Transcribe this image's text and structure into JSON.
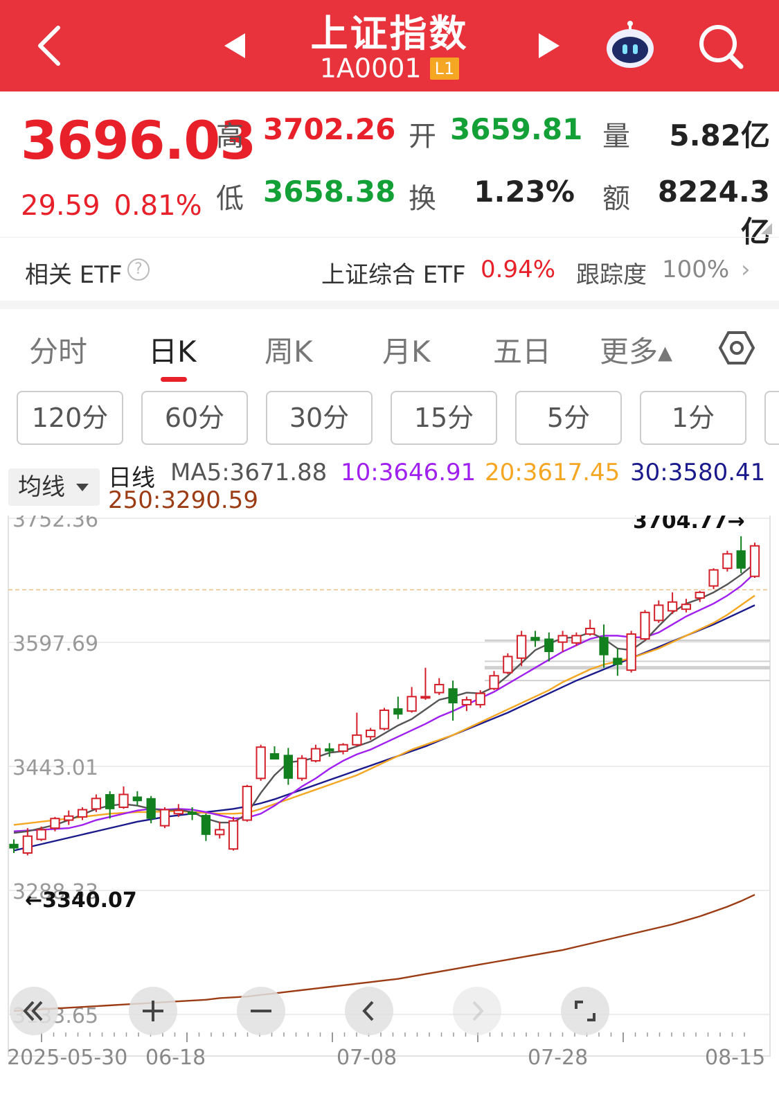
{
  "header": {
    "title": "上证指数",
    "code": "1A0001",
    "level_badge": "L1",
    "icons": [
      "back-chevron-icon",
      "prev-triangle-icon",
      "next-triangle-icon",
      "robot-assistant-icon",
      "search-icon"
    ]
  },
  "quote": {
    "price": "3696.03",
    "change": "29.59",
    "change_pct": "0.81%",
    "high_label": "高",
    "high": "3702.26",
    "low_label": "低",
    "low": "3658.38",
    "open_label": "开",
    "open": "3659.81",
    "turnover_label": "换",
    "turnover": "1.23%",
    "volume_label": "量",
    "volume": "5.82亿",
    "amount_label": "额",
    "amount": "8224.3亿"
  },
  "etf": {
    "label": "相关 ETF",
    "name": "上证综合 ETF",
    "pct": "0.94%",
    "tracking_label": "跟踪度",
    "tracking": "100%"
  },
  "tabs": [
    "分时",
    "日K",
    "周K",
    "月K",
    "五日",
    "更多▴"
  ],
  "active_tab": "日K",
  "periods": [
    "120分",
    "60分",
    "30分",
    "15分",
    "5分",
    "1分"
  ],
  "ma": {
    "selector": "均线",
    "prefix": "日线",
    "ma5": "MA5:3671.88",
    "ma10": "10:3646.91",
    "ma20": "20:3617.45",
    "ma30": "30:3580.41",
    "ma250": "250:3290.59",
    "colors": {
      "ma5": "#555555",
      "ma10": "#a020f0",
      "ma20": "#f5a623",
      "ma30": "#1a1a8c",
      "ma250": "#9c3c14"
    }
  },
  "chart_data": {
    "type": "candlestick",
    "y_ticks": [
      "3752.36",
      "3597.69",
      "3443.01",
      "3288.33",
      "3133.65"
    ],
    "ylim": [
      3133.65,
      3752.36
    ],
    "x_labels": [
      "2025-05-30",
      "06-18",
      "07-08",
      "07-28",
      "08-15"
    ],
    "high_marker": "3704.77→",
    "low_marker": "←3340.07",
    "up_color": "#d4202a",
    "down_color": "#12801e",
    "candles": [
      {
        "o": 3346,
        "h": 3352,
        "l": 3335,
        "c": 3341
      },
      {
        "o": 3335,
        "h": 3366,
        "l": 3332,
        "c": 3356
      },
      {
        "o": 3352,
        "h": 3368,
        "l": 3350,
        "c": 3364
      },
      {
        "o": 3366,
        "h": 3380,
        "l": 3362,
        "c": 3378
      },
      {
        "o": 3376,
        "h": 3388,
        "l": 3370,
        "c": 3381
      },
      {
        "o": 3380,
        "h": 3392,
        "l": 3376,
        "c": 3389
      },
      {
        "o": 3390,
        "h": 3408,
        "l": 3386,
        "c": 3403
      },
      {
        "o": 3408,
        "h": 3412,
        "l": 3378,
        "c": 3390
      },
      {
        "o": 3392,
        "h": 3418,
        "l": 3390,
        "c": 3408
      },
      {
        "o": 3405,
        "h": 3412,
        "l": 3394,
        "c": 3400
      },
      {
        "o": 3403,
        "h": 3406,
        "l": 3372,
        "c": 3378
      },
      {
        "o": 3369,
        "h": 3392,
        "l": 3366,
        "c": 3389
      },
      {
        "o": 3384,
        "h": 3396,
        "l": 3380,
        "c": 3388
      },
      {
        "o": 3386,
        "h": 3392,
        "l": 3376,
        "c": 3383
      },
      {
        "o": 3382,
        "h": 3384,
        "l": 3350,
        "c": 3358
      },
      {
        "o": 3358,
        "h": 3374,
        "l": 3353,
        "c": 3364
      },
      {
        "o": 3340,
        "h": 3380,
        "l": 3338,
        "c": 3375
      },
      {
        "o": 3376,
        "h": 3420,
        "l": 3374,
        "c": 3418
      },
      {
        "o": 3428,
        "h": 3470,
        "l": 3425,
        "c": 3467
      },
      {
        "o": 3459,
        "h": 3468,
        "l": 3452,
        "c": 3452
      },
      {
        "o": 3457,
        "h": 3466,
        "l": 3420,
        "c": 3428
      },
      {
        "o": 3428,
        "h": 3457,
        "l": 3425,
        "c": 3453
      },
      {
        "o": 3450,
        "h": 3470,
        "l": 3448,
        "c": 3465
      },
      {
        "o": 3465,
        "h": 3472,
        "l": 3455,
        "c": 3462
      },
      {
        "o": 3462,
        "h": 3472,
        "l": 3458,
        "c": 3470
      },
      {
        "o": 3470,
        "h": 3510,
        "l": 3468,
        "c": 3482
      },
      {
        "o": 3480,
        "h": 3491,
        "l": 3476,
        "c": 3488
      },
      {
        "o": 3490,
        "h": 3516,
        "l": 3488,
        "c": 3513
      },
      {
        "o": 3515,
        "h": 3530,
        "l": 3502,
        "c": 3508
      },
      {
        "o": 3512,
        "h": 3542,
        "l": 3510,
        "c": 3530
      },
      {
        "o": 3530,
        "h": 3566,
        "l": 3526,
        "c": 3530
      },
      {
        "o": 3535,
        "h": 3553,
        "l": 3532,
        "c": 3545
      },
      {
        "o": 3540,
        "h": 3550,
        "l": 3500,
        "c": 3522
      },
      {
        "o": 3520,
        "h": 3530,
        "l": 3512,
        "c": 3526
      },
      {
        "o": 3520,
        "h": 3538,
        "l": 3516,
        "c": 3534
      },
      {
        "o": 3540,
        "h": 3562,
        "l": 3538,
        "c": 3556
      },
      {
        "o": 3560,
        "h": 3584,
        "l": 3558,
        "c": 3580
      },
      {
        "o": 3578,
        "h": 3612,
        "l": 3568,
        "c": 3606
      },
      {
        "o": 3604,
        "h": 3612,
        "l": 3592,
        "c": 3600
      },
      {
        "o": 3602,
        "h": 3610,
        "l": 3574,
        "c": 3586
      },
      {
        "o": 3598,
        "h": 3612,
        "l": 3586,
        "c": 3606
      },
      {
        "o": 3597,
        "h": 3610,
        "l": 3593,
        "c": 3606
      },
      {
        "o": 3608,
        "h": 3626,
        "l": 3606,
        "c": 3615
      },
      {
        "o": 3604,
        "h": 3620,
        "l": 3566,
        "c": 3582
      },
      {
        "o": 3578,
        "h": 3590,
        "l": 3556,
        "c": 3570
      },
      {
        "o": 3563,
        "h": 3612,
        "l": 3560,
        "c": 3608
      },
      {
        "o": 3602,
        "h": 3638,
        "l": 3600,
        "c": 3635
      },
      {
        "o": 3625,
        "h": 3650,
        "l": 3622,
        "c": 3644
      },
      {
        "o": 3637,
        "h": 3660,
        "l": 3633,
        "c": 3648
      },
      {
        "o": 3639,
        "h": 3652,
        "l": 3635,
        "c": 3645
      },
      {
        "o": 3653,
        "h": 3662,
        "l": 3648,
        "c": 3660
      },
      {
        "o": 3668,
        "h": 3690,
        "l": 3664,
        "c": 3688
      },
      {
        "o": 3690,
        "h": 3712,
        "l": 3686,
        "c": 3708
      },
      {
        "o": 3712,
        "h": 3730,
        "l": 3684,
        "c": 3690
      },
      {
        "o": 3680,
        "h": 3722,
        "l": 3678,
        "c": 3718
      }
    ],
    "ma5": [
      3360,
      3362,
      3366,
      3370,
      3376,
      3383,
      3390,
      3394,
      3396,
      3394,
      3390,
      3388,
      3389,
      3386,
      3378,
      3373,
      3373,
      3384,
      3410,
      3432,
      3448,
      3450,
      3454,
      3460,
      3462,
      3468,
      3474,
      3484,
      3494,
      3502,
      3514,
      3526,
      3530,
      3535,
      3534,
      3542,
      3556,
      3572,
      3588,
      3596,
      3603,
      3604,
      3610,
      3602,
      3590,
      3588,
      3600,
      3618,
      3635,
      3646,
      3652,
      3660,
      3670,
      3682,
      3696
    ],
    "ma10": [
      3362,
      3363,
      3364,
      3365,
      3366,
      3370,
      3376,
      3380,
      3384,
      3388,
      3390,
      3389,
      3390,
      3389,
      3386,
      3382,
      3378,
      3379,
      3384,
      3394,
      3406,
      3418,
      3428,
      3440,
      3450,
      3458,
      3464,
      3472,
      3480,
      3488,
      3496,
      3505,
      3512,
      3520,
      3528,
      3536,
      3546,
      3556,
      3566,
      3576,
      3586,
      3594,
      3602,
      3606,
      3606,
      3604,
      3604,
      3610,
      3620,
      3630,
      3638,
      3646,
      3656,
      3668,
      3684
    ],
    "ma20": [
      3370,
      3372,
      3374,
      3376,
      3378,
      3380,
      3382,
      3384,
      3385,
      3386,
      3386,
      3387,
      3387,
      3386,
      3385,
      3384,
      3384,
      3385,
      3390,
      3396,
      3402,
      3408,
      3414,
      3420,
      3426,
      3432,
      3440,
      3448,
      3456,
      3464,
      3470,
      3476,
      3482,
      3490,
      3498,
      3506,
      3514,
      3522,
      3530,
      3538,
      3548,
      3556,
      3564,
      3570,
      3574,
      3578,
      3584,
      3590,
      3598,
      3606,
      3614,
      3622,
      3632,
      3644,
      3656
    ],
    "ma30": [
      3338,
      3342,
      3346,
      3350,
      3354,
      3358,
      3362,
      3366,
      3370,
      3374,
      3377,
      3380,
      3382,
      3384,
      3386,
      3388,
      3390,
      3393,
      3397,
      3402,
      3408,
      3414,
      3420,
      3426,
      3432,
      3438,
      3444,
      3450,
      3456,
      3462,
      3468,
      3475,
      3482,
      3489,
      3496,
      3503,
      3510,
      3518,
      3526,
      3534,
      3542,
      3550,
      3557,
      3564,
      3571,
      3578,
      3585,
      3592,
      3599,
      3606,
      3613,
      3620,
      3628,
      3636,
      3644
    ],
    "ma250": [
      3138,
      3139,
      3140,
      3141,
      3142,
      3143,
      3144,
      3145,
      3146,
      3147,
      3148,
      3149,
      3150,
      3151,
      3152,
      3154,
      3155,
      3156,
      3158,
      3160,
      3162,
      3164,
      3166,
      3168,
      3170,
      3172,
      3174,
      3176,
      3178,
      3181,
      3184,
      3187,
      3190,
      3193,
      3196,
      3199,
      3202,
      3205,
      3208,
      3211,
      3214,
      3218,
      3222,
      3226,
      3230,
      3234,
      3238,
      3242,
      3246,
      3251,
      3256,
      3262,
      3268,
      3275,
      3283
    ]
  }
}
